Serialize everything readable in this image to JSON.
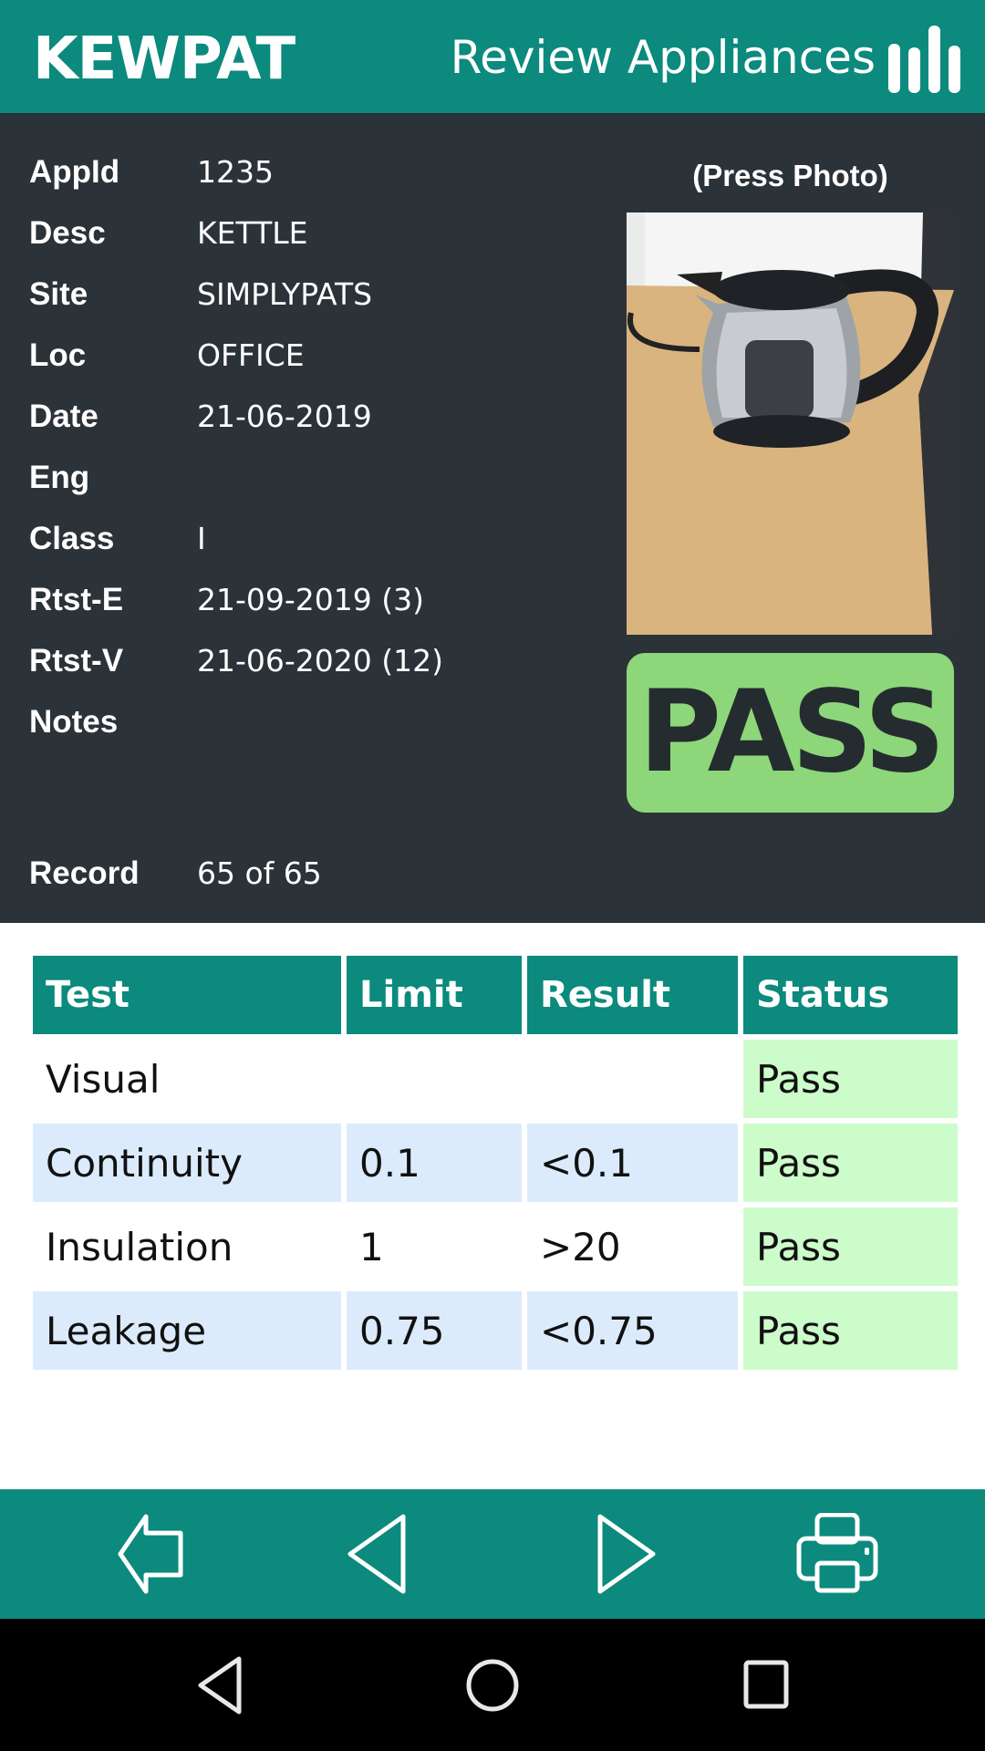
{
  "header": {
    "logo": "KEWPAT",
    "title": "Review Appliances",
    "menu_icon": "bars-icon"
  },
  "details": [
    {
      "label": "AppId",
      "value": "1235"
    },
    {
      "label": "Desc",
      "value": "KETTLE"
    },
    {
      "label": "Site",
      "value": "SIMPLYPATS"
    },
    {
      "label": "Loc",
      "value": "OFFICE"
    },
    {
      "label": "Date",
      "value": "21-06-2019"
    },
    {
      "label": "Eng",
      "value": ""
    },
    {
      "label": "Class",
      "value": "I"
    },
    {
      "label": "Rtst-E",
      "value": "21-09-2019 (3)"
    },
    {
      "label": "Rtst-V",
      "value": "21-06-2020 (12)"
    },
    {
      "label": "Notes",
      "value": ""
    }
  ],
  "record": {
    "label": "Record",
    "value": "65 of 65"
  },
  "photo": {
    "caption": "(Press Photo)"
  },
  "result": {
    "label": "PASS",
    "color": "#8dd67a"
  },
  "table": {
    "headers": [
      "Test",
      "Limit",
      "Result",
      "Status"
    ],
    "rows": [
      [
        "Visual",
        "",
        "",
        "Pass"
      ],
      [
        "Continuity",
        "0.1",
        "<0.1",
        "Pass"
      ],
      [
        "Insulation",
        "1",
        ">20",
        "Pass"
      ],
      [
        "Leakage",
        "0.75",
        "<0.75",
        "Pass"
      ]
    ]
  },
  "toolbar": [
    "back-arrow-icon",
    "previous-icon",
    "next-icon",
    "printer-icon"
  ],
  "colors": {
    "brand": "#0b8a7d",
    "panel": "#2b3238",
    "status_pass": "#cdfccb",
    "row_alt": "#dcebfc"
  }
}
